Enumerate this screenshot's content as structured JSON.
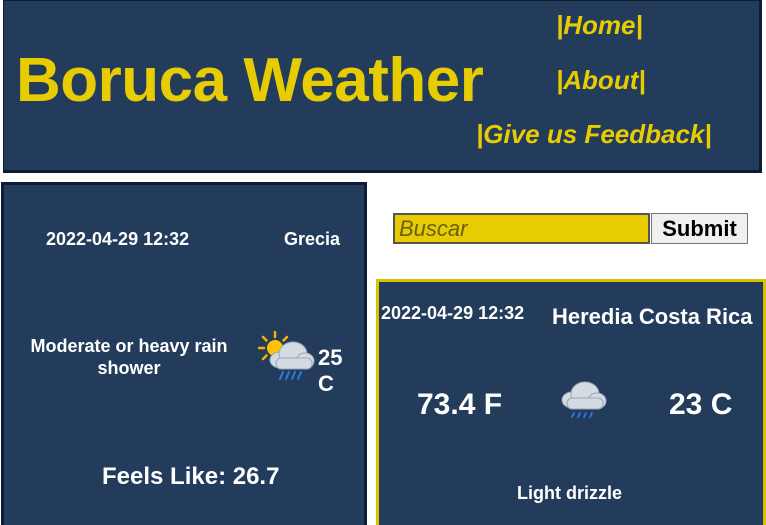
{
  "header": {
    "brand": "Boruca Weather",
    "nav": [
      "|Home|",
      "|About|",
      "|Give us Feedback|"
    ]
  },
  "left_card": {
    "datetime": "2022-04-29 12:32",
    "city": "Grecia",
    "condition": "Moderate or heavy rain shower",
    "temp_c": "25 C",
    "feels_like": "Feels Like: 26.7",
    "icon": "sun-cloud-rain-icon"
  },
  "search": {
    "placeholder": "Buscar",
    "submit_label": "Submit"
  },
  "right_card": {
    "datetime": "2022-04-29 12:32",
    "location": "Heredia Costa Rica",
    "temp_f": "73.4 F",
    "temp_c": "23 C",
    "condition": "Light drizzle",
    "icon": "cloud-drizzle-icon"
  },
  "colors": {
    "navy": "#233c5c",
    "accent": "#e6cc00"
  }
}
